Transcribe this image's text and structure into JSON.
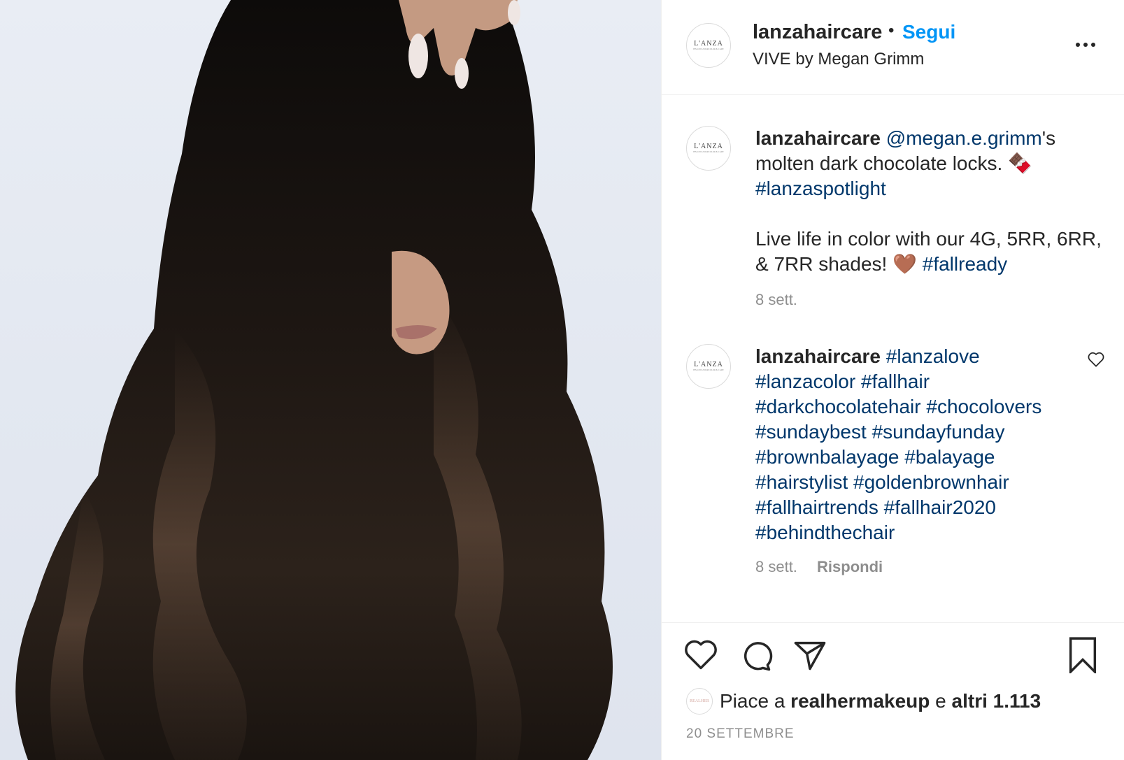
{
  "post": {
    "photo_alt": "woman with long wavy dark chocolate hair",
    "header": {
      "username": "lanzahaircare",
      "dot": "•",
      "follow_label": "Segui",
      "location": "VIVE by Megan Grimm",
      "avatar_logo": "L'ANZA",
      "avatar_sub": "HEALING HAIRCOLOR & CARE",
      "more_icon": "more-horizontal-icon"
    },
    "caption": {
      "username": "lanzahaircare",
      "mention": "@megan.e.grimm",
      "text_1": "'s molten dark chocolate locks. 🍫",
      "hashtag_1": "#lanzaspotlight",
      "text_2": "Live life in color with our 4G, 5RR, 6RR, & 7RR shades! 🤎",
      "hashtag_2": "#fallready",
      "time": "8 sett."
    },
    "comment": {
      "username": "lanzahaircare",
      "hashtags": "#lanzalove #lanzacolor #fallhair #darkchocolatehair #chocolovers #sundaybest #sundayfunday #brownbalayage #balayage #hairstylist #goldenbrownhair #fallhairtrends #fallhair2020 #behindthechair",
      "time": "8 sett.",
      "reply_label": "Rispondi",
      "like_icon": "heart-outline-icon"
    },
    "actions": {
      "like_icon": "heart-icon",
      "comment_icon": "comment-icon",
      "share_icon": "paper-plane-icon",
      "save_icon": "bookmark-icon"
    },
    "likes": {
      "prefix": "Piace a ",
      "user": "realhermakeup",
      "middle": " e ",
      "others": "altri 1.113",
      "avatar_text": "REALHER"
    },
    "date": "20 SETTEMBRE"
  }
}
